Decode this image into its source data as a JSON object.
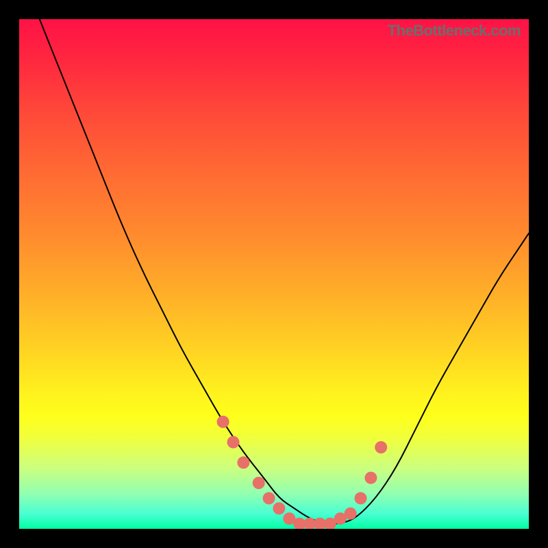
{
  "watermark": {
    "text": "TheBottleneck.com"
  },
  "colors": {
    "curve_stroke": "#000000",
    "marker_fill": "#e77069",
    "marker_stroke": "#d04c45",
    "gradient_top": "#ff1246",
    "gradient_bottom": "#01ffa4",
    "background": "#000000"
  },
  "chart_data": {
    "type": "line",
    "title": "",
    "xlabel": "",
    "ylabel": "",
    "xlim": [
      0,
      100
    ],
    "ylim": [
      0,
      100
    ],
    "series": [
      {
        "name": "bottleneck-curve",
        "x": [
          4,
          8,
          12,
          16,
          20,
          24,
          28,
          32,
          36,
          40,
          44,
          48,
          51,
          54,
          57,
          60,
          63,
          66,
          70,
          74,
          78,
          82,
          86,
          90,
          94,
          98,
          100
        ],
        "y": [
          100,
          90,
          80,
          70,
          60,
          51,
          43,
          35,
          28,
          21,
          15,
          10,
          6,
          4,
          2,
          1,
          1,
          2,
          6,
          12,
          20,
          28,
          35,
          42,
          49,
          55,
          58
        ]
      }
    ],
    "markers": {
      "name": "highlighted-points",
      "x": [
        40,
        42,
        44,
        47,
        49,
        51,
        53,
        55,
        57,
        59,
        61,
        63,
        65,
        67,
        69,
        71
      ],
      "y": [
        21,
        17,
        13,
        9,
        6,
        4,
        2,
        1,
        1,
        1,
        1,
        2,
        3,
        6,
        10,
        16
      ]
    }
  }
}
